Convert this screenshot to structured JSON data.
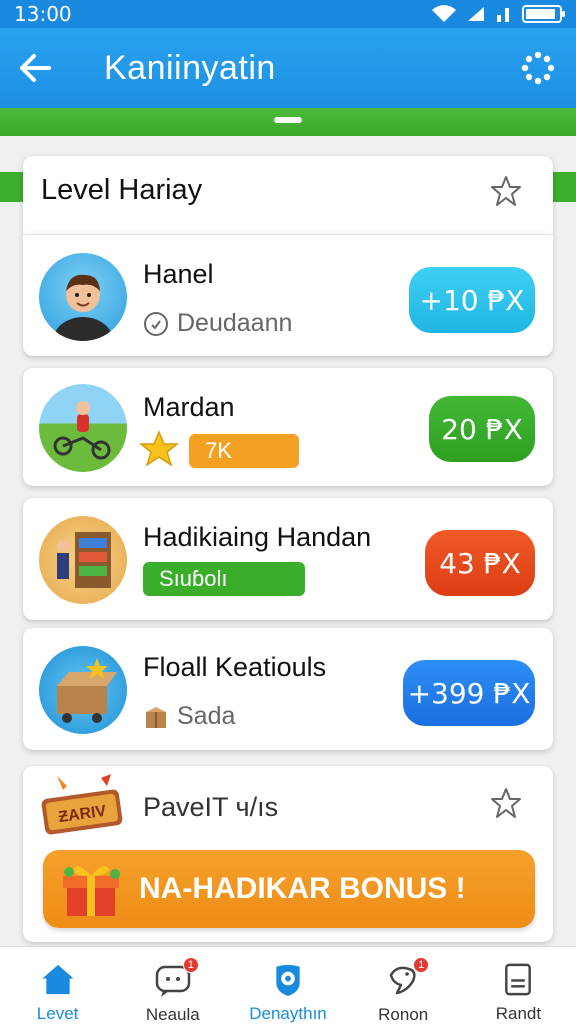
{
  "status_bar": {
    "time": "13:00"
  },
  "app_bar": {
    "title": "Kaniinyatin"
  },
  "section": {
    "title": "Level Hariay"
  },
  "rows": [
    {
      "title": "Hanel",
      "subtitle": "Deudaann",
      "price": "+10 ₱X",
      "price_color": "#2fc3ea"
    },
    {
      "title": "Mardan",
      "tag": "7K",
      "price": "20 ₱X",
      "price_color": "#3aae2b"
    },
    {
      "title": "Hadikiaing Handan",
      "tag": "Sıuɓolı",
      "price": "43 ₱X",
      "price_color": "#e84a1f"
    },
    {
      "title": "Floall Keatiouls",
      "subtitle": "Sada",
      "price": "+399 ₱X",
      "price_color": "#1f7ff0"
    }
  ],
  "bonus": {
    "title": "PaveIT ч/ıs",
    "chest_label": "ƵARIV",
    "button_label": "NA-HADIKAR BONUS !"
  },
  "nav": [
    {
      "label": "Levet",
      "icon": "home-icon",
      "active": true
    },
    {
      "label": "Neaula",
      "icon": "chat-icon",
      "badge": "1"
    },
    {
      "label": "Denaythın",
      "icon": "shield-icon"
    },
    {
      "label": "Ronon",
      "icon": "bird-icon",
      "badge": "1"
    },
    {
      "label": "Randt",
      "icon": "note-icon"
    }
  ],
  "colors": {
    "primary_blue": "#1e8fe3",
    "green": "#3cae2e",
    "orange": "#f39a22"
  }
}
